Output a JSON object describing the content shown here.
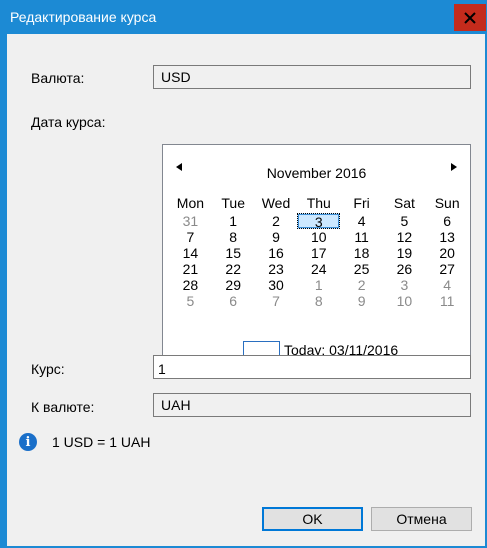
{
  "window": {
    "title": "Редактирование курса"
  },
  "fields": {
    "currency_label": "Валюта:",
    "currency_value": "USD",
    "date_label": "Дата курса:",
    "rate_label": "Курс:",
    "rate_value": "1",
    "to_currency_label": "К валюте:",
    "to_currency_value": "UAH"
  },
  "calendar": {
    "month_title": "November 2016",
    "weekdays": [
      "Mon",
      "Tue",
      "Wed",
      "Thu",
      "Fri",
      "Sat",
      "Sun"
    ],
    "weeks": [
      [
        {
          "d": "31",
          "g": true
        },
        {
          "d": "1"
        },
        {
          "d": "2"
        },
        {
          "d": "3",
          "sel": true
        },
        {
          "d": "4"
        },
        {
          "d": "5"
        },
        {
          "d": "6"
        }
      ],
      [
        {
          "d": "7"
        },
        {
          "d": "8"
        },
        {
          "d": "9"
        },
        {
          "d": "10"
        },
        {
          "d": "11"
        },
        {
          "d": "12"
        },
        {
          "d": "13"
        }
      ],
      [
        {
          "d": "14"
        },
        {
          "d": "15"
        },
        {
          "d": "16"
        },
        {
          "d": "17"
        },
        {
          "d": "18"
        },
        {
          "d": "19"
        },
        {
          "d": "20"
        }
      ],
      [
        {
          "d": "21"
        },
        {
          "d": "22"
        },
        {
          "d": "23"
        },
        {
          "d": "24"
        },
        {
          "d": "25"
        },
        {
          "d": "26"
        },
        {
          "d": "27"
        }
      ],
      [
        {
          "d": "28"
        },
        {
          "d": "29"
        },
        {
          "d": "30"
        },
        {
          "d": "1",
          "g": true
        },
        {
          "d": "2",
          "g": true
        },
        {
          "d": "3",
          "g": true
        },
        {
          "d": "4",
          "g": true
        }
      ],
      [
        {
          "d": "5",
          "g": true
        },
        {
          "d": "6",
          "g": true
        },
        {
          "d": "7",
          "g": true
        },
        {
          "d": "8",
          "g": true
        },
        {
          "d": "9",
          "g": true
        },
        {
          "d": "10",
          "g": true
        },
        {
          "d": "11",
          "g": true
        }
      ]
    ],
    "today_label": "Today: 03/11/2016"
  },
  "info": {
    "icon": "info-icon",
    "text": "1 USD = 1 UAH"
  },
  "buttons": {
    "ok_label": "OK",
    "cancel_label": "Отмена"
  },
  "colors": {
    "title_bar": "#1c8ad4",
    "close_button": "#c42b1c",
    "accent": "#0078d7"
  }
}
